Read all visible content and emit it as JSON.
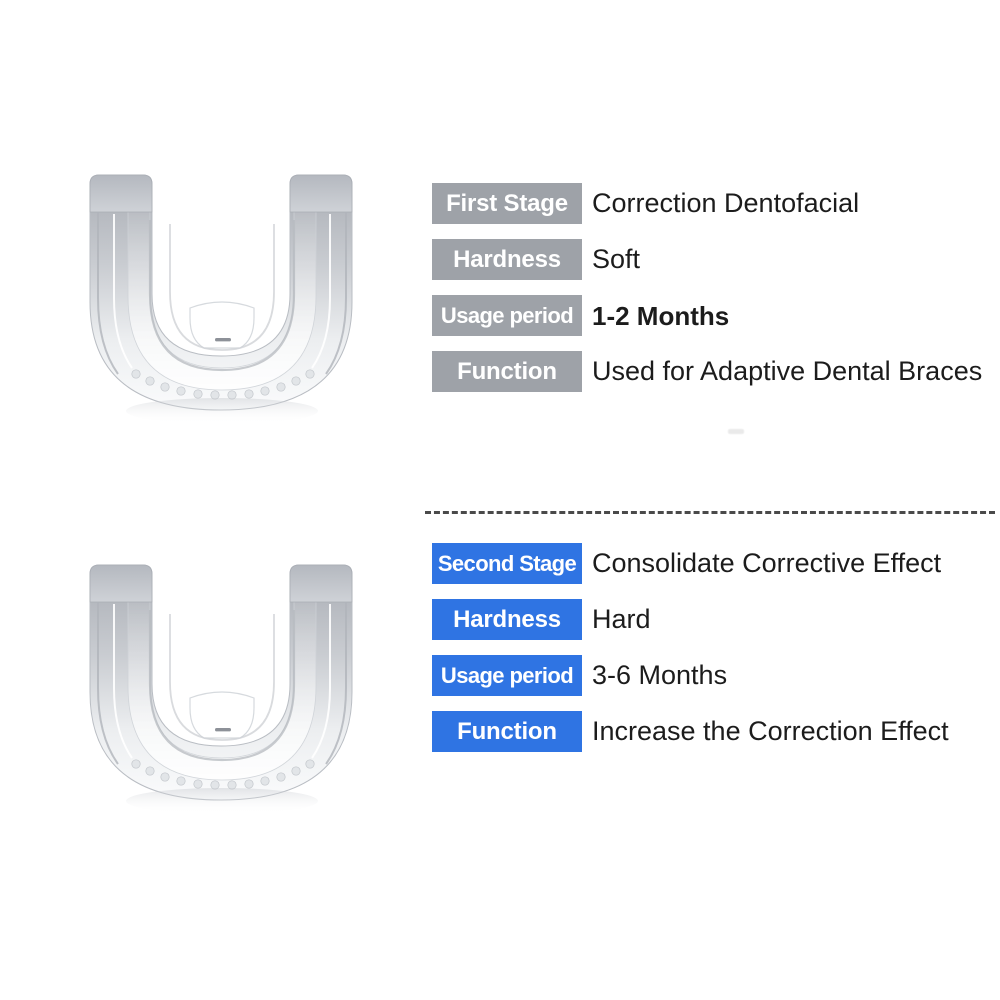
{
  "page": {
    "background_color": "#ffffff",
    "product_name": "dental-aligner-mouthguard"
  },
  "colors": {
    "stage_one_badge": "#9ea2a8",
    "stage_two_badge": "#2f74e3",
    "badge_text": "#ffffff",
    "value_text": "#1c1c1c",
    "divider": "#4a4a4a"
  },
  "stages": [
    {
      "id": "first-stage",
      "accent": "#9ea2a8",
      "product_icon": "dental-aligner-icon",
      "rows": [
        {
          "label": "First Stage",
          "value": "Correction  Dentofacial",
          "bold": false
        },
        {
          "label": "Hardness",
          "value": "Soft",
          "bold": false
        },
        {
          "label": "Usage period",
          "value": "1-2 Months",
          "bold": true
        },
        {
          "label": "Function",
          "value": "Used for Adaptive Dental Braces",
          "bold": false
        }
      ]
    },
    {
      "id": "second-stage",
      "accent": "#2f74e3",
      "product_icon": "dental-aligner-icon",
      "rows": [
        {
          "label": "Second Stage",
          "value": "Consolidate Corrective Effect",
          "bold": false
        },
        {
          "label": "Hardness",
          "value": "Hard",
          "bold": false
        },
        {
          "label": "Usage period",
          "value": "3-6 Months",
          "bold": false
        },
        {
          "label": "Function",
          "value": "Increase the Correction Effect",
          "bold": false
        }
      ]
    }
  ]
}
